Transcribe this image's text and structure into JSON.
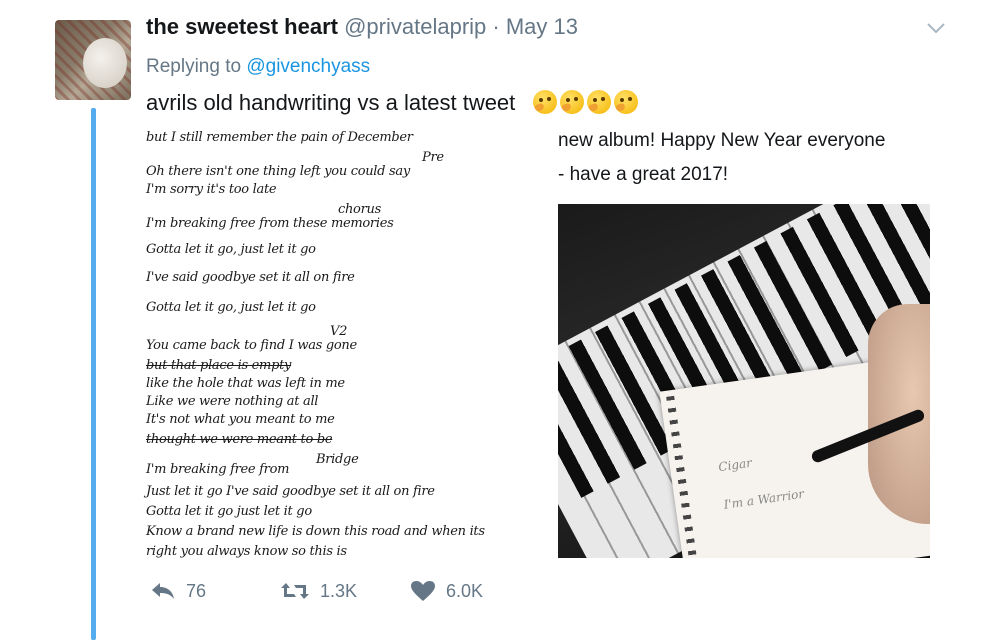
{
  "tweet": {
    "display_name": "the sweetest heart",
    "handle": "@privatelaprip",
    "separator": "·",
    "date": "May 13",
    "replying_prefix": "Replying to ",
    "replying_to": "@givenchyass",
    "text": "avrils old handwriting vs a latest tweet",
    "emoji_count_icons": [
      "thinking-face-icon",
      "thinking-face-icon",
      "thinking-face-icon",
      "thinking-face-icon"
    ]
  },
  "media_left": {
    "lines": [
      "but I still remember the pain of December",
      "Oh there isn't one thing left you could say",
      "I'm sorry it's too late",
      "I'm breaking free from these memories",
      "Gotta let it go, just let it go",
      "I've said goodbye set it all on fire",
      "Gotta let it go, just let it go",
      "You came back to find I was gone",
      "but that place is empty",
      "like the hole that was left in me",
      "Like we were nothing at all",
      "It's not what you meant to me",
      "thought we were meant to be",
      "I'm breaking free from",
      "Just let it go I've said goodbye set it all on fire",
      "Gotta let it go just let it go",
      "Know a brand new life is down this road and when its",
      "right you always know so this is"
    ],
    "annotations": [
      "Pre",
      "chorus",
      "V2",
      "Bridge"
    ]
  },
  "media_right": {
    "line1": "new album! Happy New Year everyone",
    "line2": "- have a great 2017!",
    "notebook_lines": [
      "Cigar",
      "I'm a Warrior"
    ]
  },
  "actions": {
    "reply_count": "76",
    "retweet_count": "1.3K",
    "like_count": "6.0K"
  },
  "colors": {
    "thread_line": "#55acee",
    "mention": "#1b95e0",
    "secondary_text": "#657786"
  }
}
